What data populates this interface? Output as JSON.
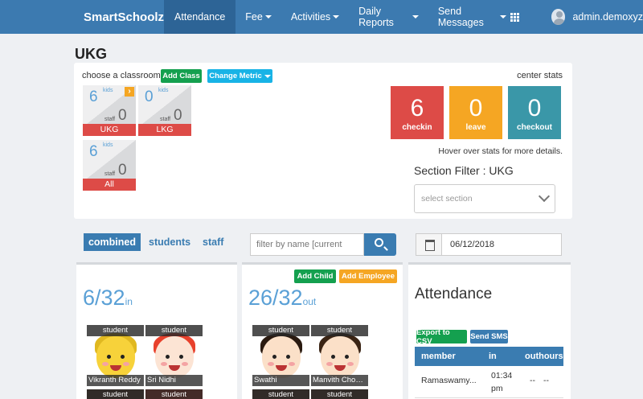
{
  "nav": {
    "brand": "SmartSchoolz",
    "items": [
      {
        "label": "Attendance",
        "active": true
      },
      {
        "label": "Fee"
      },
      {
        "label": "Activities"
      },
      {
        "label": "Daily Reports"
      },
      {
        "label": "Send Messages"
      }
    ],
    "user": "admin.demoxyz"
  },
  "page_title": "UKG",
  "classroom": {
    "choose_label": "choose a classroom",
    "add_class": "Add Class",
    "change_metric": "Change Metric",
    "kids_label": "kids",
    "staff_label": "staff",
    "cards": [
      {
        "name": "UKG",
        "kids": "6",
        "staff": "0"
      },
      {
        "name": "LKG",
        "kids": "0",
        "staff": "0"
      },
      {
        "name": "All",
        "kids": "6",
        "staff": "0"
      }
    ]
  },
  "center_stats": {
    "label": "center stats",
    "stats": [
      {
        "value": "6",
        "label": "checkin",
        "color": "#dd4b47"
      },
      {
        "value": "0",
        "label": "leave",
        "color": "#f5a623"
      },
      {
        "value": "0",
        "label": "checkout",
        "color": "#3a97a8"
      }
    ],
    "hover_note": "Hover over stats for more details."
  },
  "section_filter": {
    "label": "Section Filter : UKG",
    "placeholder": "select section"
  },
  "filters": {
    "tabs": [
      "combined",
      "students",
      "staff"
    ],
    "search_placeholder": "filter by name [current",
    "date": "06/12/2018"
  },
  "in_card": {
    "count": "6/32",
    "suffix": "in",
    "people": [
      {
        "role": "student",
        "name": "Vikranth Reddy"
      },
      {
        "role": "student",
        "name": "Sri Nidhi"
      }
    ],
    "more_roles": [
      "student",
      "student"
    ]
  },
  "out_card": {
    "count": "26/32",
    "suffix": "out",
    "add_child": "Add Child",
    "add_employee": "Add Employee",
    "people": [
      {
        "role": "student",
        "name": "Swathi"
      },
      {
        "role": "student",
        "name": "Manvith Chowdary"
      }
    ],
    "more_roles": [
      "student",
      "student"
    ]
  },
  "attendance": {
    "title": "Attendance",
    "export_csv": "Export to CSV",
    "send_sms": "Send SMS",
    "columns": [
      "member",
      "in",
      "outhours"
    ],
    "rows": [
      {
        "member": "Ramaswamy...",
        "in_time": "01:34",
        "in_ampm": "pm",
        "out": "--",
        "hours": "--"
      }
    ]
  }
}
